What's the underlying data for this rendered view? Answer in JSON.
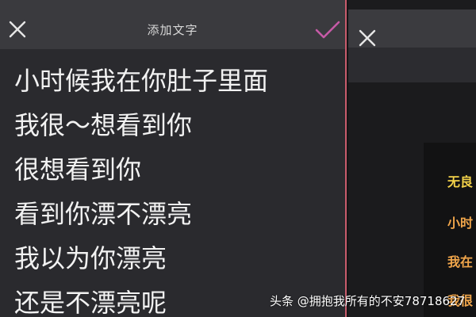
{
  "editor": {
    "title": "添加文字",
    "close_icon": "close-icon",
    "confirm_icon": "check-icon",
    "confirm_color": "#c65aa6",
    "lines": [
      "小时候我在你肚子里面",
      "我很～想看到你",
      "很想看到你",
      "看到你漂不漂亮",
      "我以为你漂亮",
      "还是不漂亮呢"
    ]
  },
  "preview": {
    "close_icon": "close-icon",
    "lines": [
      "无良",
      "小时",
      "我在",
      "我很"
    ],
    "colors": {
      "gold": "#f3d24a",
      "orange": "#f1a64b"
    }
  },
  "watermark": {
    "text": "头条 @拥抱我所有的不安78718627"
  }
}
